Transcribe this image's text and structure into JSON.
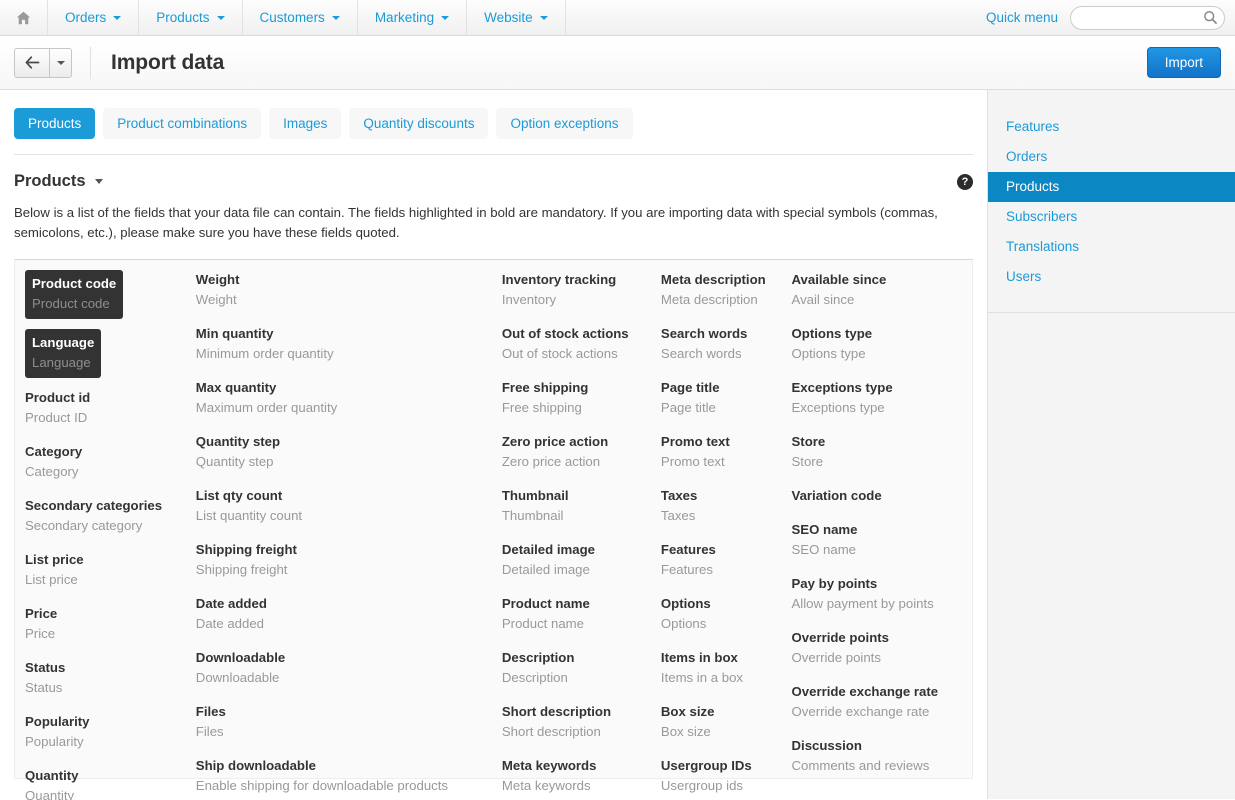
{
  "topnav": {
    "home_icon": "home-icon",
    "items": [
      {
        "label": "Orders"
      },
      {
        "label": "Products"
      },
      {
        "label": "Customers"
      },
      {
        "label": "Marketing"
      },
      {
        "label": "Website"
      }
    ],
    "quick_menu": "Quick menu",
    "search_placeholder": "",
    "search_value": "",
    "search_icon": "search-icon"
  },
  "titlebar": {
    "back_icon": "arrow-left-icon",
    "dropdown_icon": "chevron-down-icon",
    "title": "Import data",
    "import_label": "Import"
  },
  "tabs": [
    {
      "label": "Products",
      "active": true
    },
    {
      "label": "Product combinations",
      "active": false
    },
    {
      "label": "Images",
      "active": false
    },
    {
      "label": "Quantity discounts",
      "active": false
    },
    {
      "label": "Option exceptions",
      "active": false
    }
  ],
  "section": {
    "title": "Products",
    "caret_icon": "chevron-down-icon",
    "help_icon": "help-icon",
    "help_glyph": "?",
    "description": "Below is a list of the fields that your data file can contain. The fields highlighted in bold are mandatory. If you are importing data with special symbols (commas, semicolons, etc.), please make sure you have these fields quoted."
  },
  "fields": {
    "col1": [
      {
        "name": "Product code",
        "desc": "Product code",
        "mandatory": true
      },
      {
        "name": "Language",
        "desc": "Language",
        "mandatory": true
      },
      {
        "name": "Product id",
        "desc": "Product ID",
        "mandatory": false
      },
      {
        "name": "Category",
        "desc": "Category",
        "mandatory": false
      },
      {
        "name": "Secondary categories",
        "desc": "Secondary category",
        "mandatory": false
      },
      {
        "name": "List price",
        "desc": "List price",
        "mandatory": false
      },
      {
        "name": "Price",
        "desc": "Price",
        "mandatory": false
      },
      {
        "name": "Status",
        "desc": "Status",
        "mandatory": false
      },
      {
        "name": "Popularity",
        "desc": "Popularity",
        "mandatory": false
      },
      {
        "name": "Quantity",
        "desc": "Quantity",
        "mandatory": false
      }
    ],
    "col2": [
      {
        "name": "Weight",
        "desc": "Weight",
        "mandatory": false
      },
      {
        "name": "Min quantity",
        "desc": "Minimum order quantity",
        "mandatory": false
      },
      {
        "name": "Max quantity",
        "desc": "Maximum order quantity",
        "mandatory": false
      },
      {
        "name": "Quantity step",
        "desc": "Quantity step",
        "mandatory": false
      },
      {
        "name": "List qty count",
        "desc": "List quantity count",
        "mandatory": false
      },
      {
        "name": "Shipping freight",
        "desc": "Shipping freight",
        "mandatory": false
      },
      {
        "name": "Date added",
        "desc": "Date added",
        "mandatory": false
      },
      {
        "name": "Downloadable",
        "desc": "Downloadable",
        "mandatory": false
      },
      {
        "name": "Files",
        "desc": "Files",
        "mandatory": false
      },
      {
        "name": "Ship downloadable",
        "desc": "Enable shipping for downloadable products",
        "mandatory": false
      }
    ],
    "col3": [
      {
        "name": "Inventory tracking",
        "desc": "Inventory",
        "mandatory": false
      },
      {
        "name": "Out of stock actions",
        "desc": "Out of stock actions",
        "mandatory": false
      },
      {
        "name": "Free shipping",
        "desc": "Free shipping",
        "mandatory": false
      },
      {
        "name": "Zero price action",
        "desc": "Zero price action",
        "mandatory": false
      },
      {
        "name": "Thumbnail",
        "desc": "Thumbnail",
        "mandatory": false
      },
      {
        "name": "Detailed image",
        "desc": "Detailed image",
        "mandatory": false
      },
      {
        "name": "Product name",
        "desc": "Product name",
        "mandatory": false
      },
      {
        "name": "Description",
        "desc": "Description",
        "mandatory": false
      },
      {
        "name": "Short description",
        "desc": "Short description",
        "mandatory": false
      },
      {
        "name": "Meta keywords",
        "desc": "Meta keywords",
        "mandatory": false
      }
    ],
    "col4": [
      {
        "name": "Meta description",
        "desc": "Meta description",
        "mandatory": false
      },
      {
        "name": "Search words",
        "desc": "Search words",
        "mandatory": false
      },
      {
        "name": "Page title",
        "desc": "Page title",
        "mandatory": false
      },
      {
        "name": "Promo text",
        "desc": "Promo text",
        "mandatory": false
      },
      {
        "name": "Taxes",
        "desc": "Taxes",
        "mandatory": false
      },
      {
        "name": "Features",
        "desc": "Features",
        "mandatory": false
      },
      {
        "name": "Options",
        "desc": "Options",
        "mandatory": false
      },
      {
        "name": "Items in box",
        "desc": "Items in a box",
        "mandatory": false
      },
      {
        "name": "Box size",
        "desc": "Box size",
        "mandatory": false
      },
      {
        "name": "Usergroup IDs",
        "desc": "Usergroup ids",
        "mandatory": false
      }
    ],
    "col5": [
      {
        "name": "Available since",
        "desc": "Avail since",
        "mandatory": false
      },
      {
        "name": "Options type",
        "desc": "Options type",
        "mandatory": false
      },
      {
        "name": "Exceptions type",
        "desc": "Exceptions type",
        "mandatory": false
      },
      {
        "name": "Store",
        "desc": "Store",
        "mandatory": false
      },
      {
        "name": "Variation code",
        "desc": "",
        "mandatory": false
      },
      {
        "name": "SEO name",
        "desc": "SEO name",
        "mandatory": false
      },
      {
        "name": "Pay by points",
        "desc": "Allow payment by points",
        "mandatory": false
      },
      {
        "name": "Override points",
        "desc": "Override points",
        "mandatory": false
      },
      {
        "name": "Override exchange rate",
        "desc": "Override exchange rate",
        "mandatory": false
      },
      {
        "name": "Discussion",
        "desc": "Comments and reviews",
        "mandatory": false
      }
    ]
  },
  "sidebar": {
    "items": [
      {
        "label": "Features",
        "active": false
      },
      {
        "label": "Orders",
        "active": false
      },
      {
        "label": "Products",
        "active": true
      },
      {
        "label": "Subscribers",
        "active": false
      },
      {
        "label": "Translations",
        "active": false
      },
      {
        "label": "Users",
        "active": false
      }
    ]
  },
  "colors": {
    "accent": "#1b9bd8",
    "accent_dark": "#0b87c4",
    "mandatory_bg": "#333333",
    "panel_bg": "#fafafa",
    "sidebar_bg": "#f4f4f4"
  }
}
